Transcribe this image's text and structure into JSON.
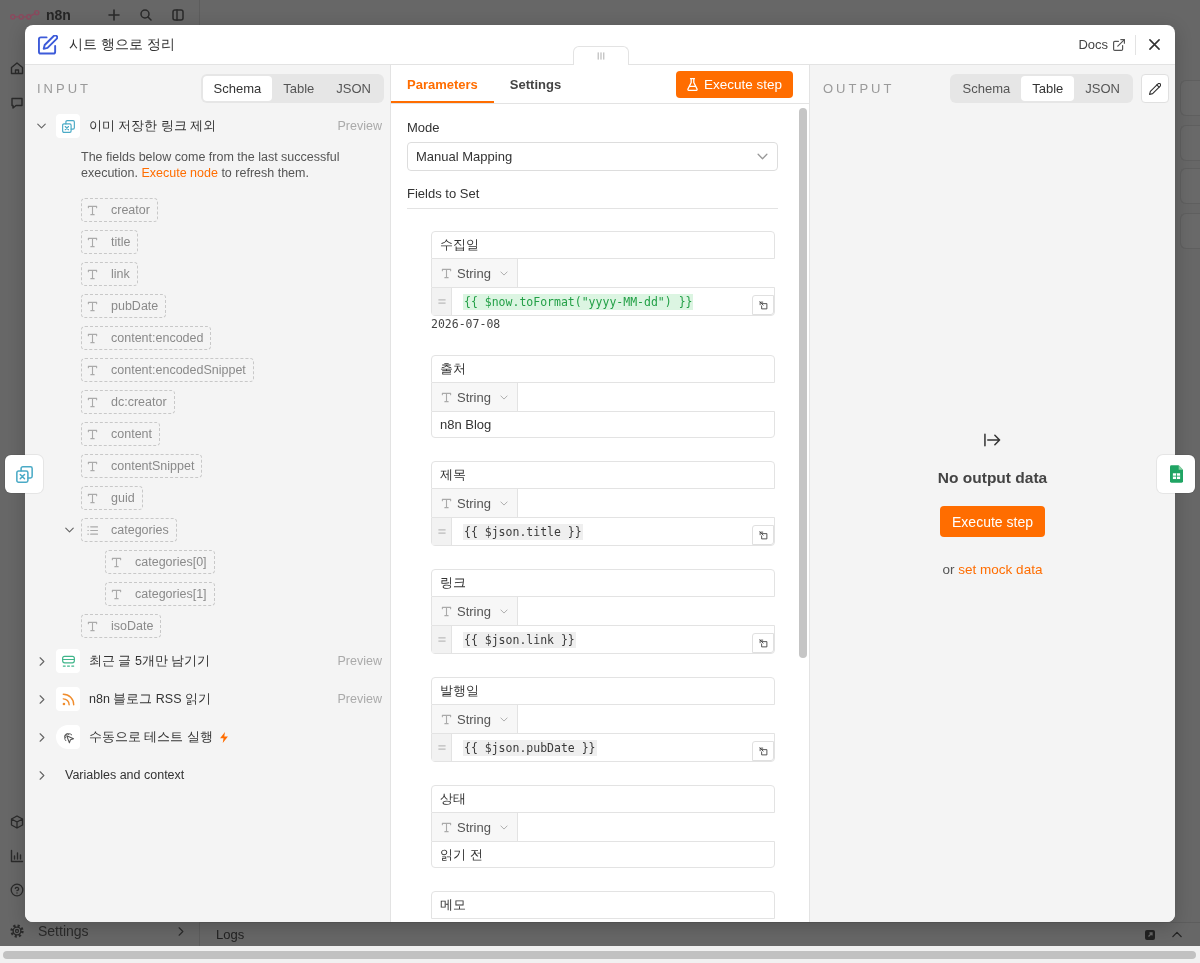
{
  "app": {
    "brand": "n8n",
    "settings_label": "Settings",
    "logs_label": "Logs"
  },
  "modal": {
    "title": "시트 행으로 정리",
    "docs_link": "Docs"
  },
  "input_panel": {
    "heading": "INPUT",
    "views": [
      {
        "label": "Schema",
        "selected": true
      },
      {
        "label": "Table",
        "selected": false
      },
      {
        "label": "JSON",
        "selected": false
      }
    ],
    "nodes": [
      {
        "kind": "filter",
        "name": "이미 저장한 링크 제외",
        "expanded": true,
        "action": "Preview",
        "notice": {
          "text": "The fields below come from the last successful execution.",
          "link": "Execute node",
          "after": "to refresh them."
        },
        "fields": [
          {
            "kind": "string",
            "name": "creator"
          },
          {
            "kind": "string",
            "name": "title"
          },
          {
            "kind": "string",
            "name": "link"
          },
          {
            "kind": "string",
            "name": "pubDate"
          },
          {
            "kind": "string",
            "name": "content:encoded"
          },
          {
            "kind": "string",
            "name": "content:encodedSnippet"
          },
          {
            "kind": "string",
            "name": "dc:creator"
          },
          {
            "kind": "string",
            "name": "content"
          },
          {
            "kind": "string",
            "name": "contentSnippet"
          },
          {
            "kind": "string",
            "name": "guid"
          },
          {
            "kind": "array",
            "name": "categories",
            "expanded": true,
            "children": [
              {
                "kind": "string",
                "name": "categories[0]"
              },
              {
                "kind": "string",
                "name": "categories[1]"
              }
            ]
          },
          {
            "kind": "string",
            "name": "isoDate"
          }
        ]
      },
      {
        "kind": "limit",
        "name": "최근 글 5개만 남기기",
        "expanded": false,
        "action": "Preview"
      },
      {
        "kind": "rss",
        "name": "n8n 블로그 RSS 읽기",
        "expanded": false,
        "action": "Preview"
      },
      {
        "kind": "trigger",
        "name": "수동으로 테스트 실행",
        "expanded": false
      }
    ],
    "variables": {
      "label": "Variables and context",
      "expanded": false
    }
  },
  "parameters_panel": {
    "tabs": [
      {
        "label": "Parameters",
        "selected": true
      },
      {
        "label": "Settings",
        "selected": false
      }
    ],
    "execute_button": "Execute step",
    "mode": {
      "label": "Mode",
      "value": "Manual Mapping"
    },
    "fields_heading": "Fields to Set",
    "assignments": [
      {
        "name": "수집일",
        "type": "String",
        "kind": "expression",
        "value": "{{ $now.toFormat(\"yyyy-MM-dd\") }}",
        "resolved": true,
        "result": "2026-07-08"
      },
      {
        "name": "출처",
        "type": "String",
        "kind": "fixed",
        "value": "n8n Blog"
      },
      {
        "name": "제목",
        "type": "String",
        "kind": "expression",
        "value": "{{ $json.title }}",
        "resolved": false
      },
      {
        "name": "링크",
        "type": "String",
        "kind": "expression",
        "value": "{{ $json.link }}",
        "resolved": false
      },
      {
        "name": "발행일",
        "type": "String",
        "kind": "expression",
        "value": "{{ $json.pubDate }}",
        "resolved": false
      },
      {
        "name": "상태",
        "type": "String",
        "kind": "fixed",
        "value": "읽기 전"
      },
      {
        "name": "메모"
      }
    ]
  },
  "output_panel": {
    "heading": "OUTPUT",
    "views": [
      {
        "label": "Schema",
        "selected": false
      },
      {
        "label": "Table",
        "selected": true
      },
      {
        "label": "JSON",
        "selected": false
      }
    ],
    "empty_state": {
      "title": "No output data",
      "button": "Execute step",
      "text": "or",
      "link": "set mock data"
    }
  }
}
